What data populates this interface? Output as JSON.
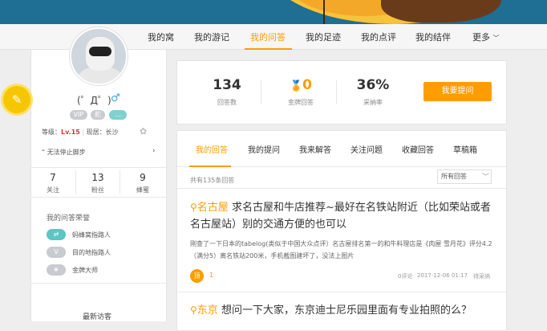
{
  "colors": {
    "accent": "#ff9d00",
    "banner": "#1f6e93",
    "level_red": "#e62e2e",
    "male_blue": "#3da3e8"
  },
  "nav": {
    "items": [
      "我的窝",
      "我的游记",
      "我的问答",
      "我的足迹",
      "我的点评",
      "我的结伴",
      "更多"
    ],
    "active_index": 2
  },
  "profile": {
    "coin_icon": "edit-icon",
    "name": "(゜Д゜)",
    "gender_symbol": "♂",
    "badges": [
      "VIP",
      "舵",
      "…"
    ],
    "level_label": "等级：",
    "level_value": "Lv.15",
    "residence": "现居：长沙",
    "motto": "“ 无法停止脚步",
    "more_arrow": "›",
    "stats": [
      {
        "value": "7",
        "label": "关注"
      },
      {
        "value": "13",
        "label": "粉丝"
      },
      {
        "value": "9",
        "label": "蜂蜜"
      }
    ],
    "honor_title": "我的问答荣誉",
    "honors": [
      {
        "icon": "route-icon",
        "label": "蚂蜂窝指路人"
      },
      {
        "icon": "pin-icon",
        "label": "目的地指路人"
      },
      {
        "icon": "star-icon",
        "label": "金牌大师"
      }
    ],
    "recent_visitors_title": "最新访客"
  },
  "summary": {
    "answers": {
      "value": "134",
      "label": "回答数"
    },
    "gold": {
      "value": "0",
      "label": "金牌回答"
    },
    "rate": {
      "value": "36%",
      "label": "采纳率"
    },
    "ask_button": "我要提问"
  },
  "tabs": [
    "我的回答",
    "我的提问",
    "我来解答",
    "关注问题",
    "收藏回答",
    "草稿箱"
  ],
  "list": {
    "count_text": "共有135条回答",
    "filter_value": "所有回答",
    "questions": [
      {
        "location": "名古屋",
        "title": "求名古屋和牛店推荐~最好在名铁站附近（比如荣站或者名古屋站）别的交通方便的也可以",
        "excerpt": "刚查了一下日本的tabelog(类似于中国大众点评）名古屋排名第一的和牛料理店是《肉屋 雪月花》评分4.2（满分5）离名铁站200米，手机截图建坏了，没法上图片",
        "badge": "顶",
        "votes": "1",
        "comments": "0评论",
        "date": "2017-12-06 01:17",
        "status": "待采纳"
      },
      {
        "location": "东京",
        "title": "想问一下大家，东京迪士尼乐园里面有专业拍照的么？"
      }
    ]
  }
}
